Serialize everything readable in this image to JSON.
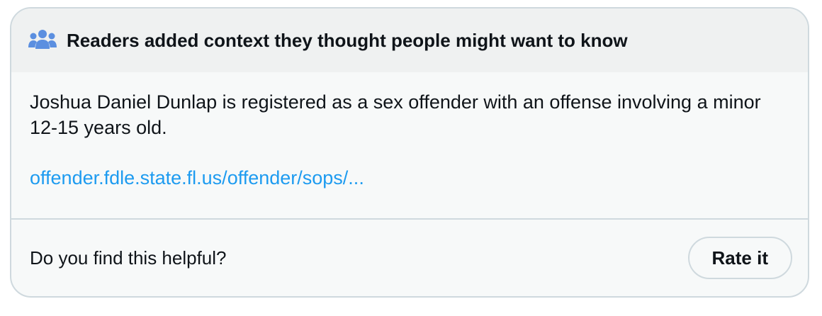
{
  "note": {
    "header_text": "Readers added context they thought people might want to know",
    "header_icon": "people-icon",
    "body_text": "Joshua Daniel Dunlap is registered as a sex offender with an offense involving a minor 12-15 years old.",
    "link_text": "offender.fdle.state.fl.us/offender/sops/..."
  },
  "footer": {
    "question": "Do you find this helpful?",
    "rate_button_label": "Rate it"
  },
  "colors": {
    "accent_icon": "#5b8fe0",
    "link": "#1d9bf0",
    "text": "#0f1419",
    "border": "#cfd9de",
    "header_bg": "#eff1f1",
    "body_bg": "#f7f9f9"
  }
}
